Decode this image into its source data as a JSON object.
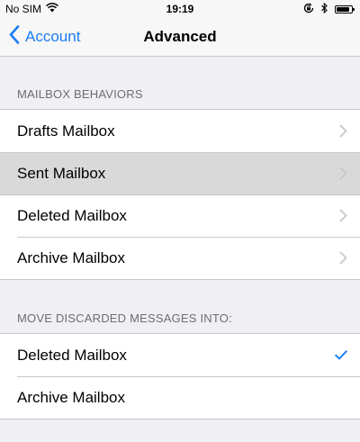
{
  "status_bar": {
    "carrier": "No SIM",
    "time": "19:19",
    "icons": [
      "wifi-icon",
      "orientation-lock-icon",
      "bluetooth-icon",
      "battery-icon"
    ],
    "battery_level": 0.9
  },
  "nav": {
    "back_label": "Account",
    "title": "Advanced"
  },
  "mailbox_behaviors": {
    "header": "MAILBOX BEHAVIORS",
    "items": [
      {
        "label": "Drafts Mailbox",
        "accessory": "chevron-right-icon",
        "highlighted": false
      },
      {
        "label": "Sent Mailbox",
        "accessory": "chevron-right-icon",
        "highlighted": true
      },
      {
        "label": "Deleted Mailbox",
        "accessory": "chevron-right-icon",
        "highlighted": false
      },
      {
        "label": "Archive Mailbox",
        "accessory": "chevron-right-icon",
        "highlighted": false
      }
    ]
  },
  "discarded": {
    "header": "MOVE DISCARDED MESSAGES INTO:",
    "items": [
      {
        "label": "Deleted Mailbox",
        "checked": true
      },
      {
        "label": "Archive Mailbox",
        "checked": false
      }
    ]
  },
  "colors": {
    "accent": "#1a7cf5",
    "chevron": "#c7c7cc",
    "highlight": "#d9d9d9",
    "background": "#efeff4"
  }
}
